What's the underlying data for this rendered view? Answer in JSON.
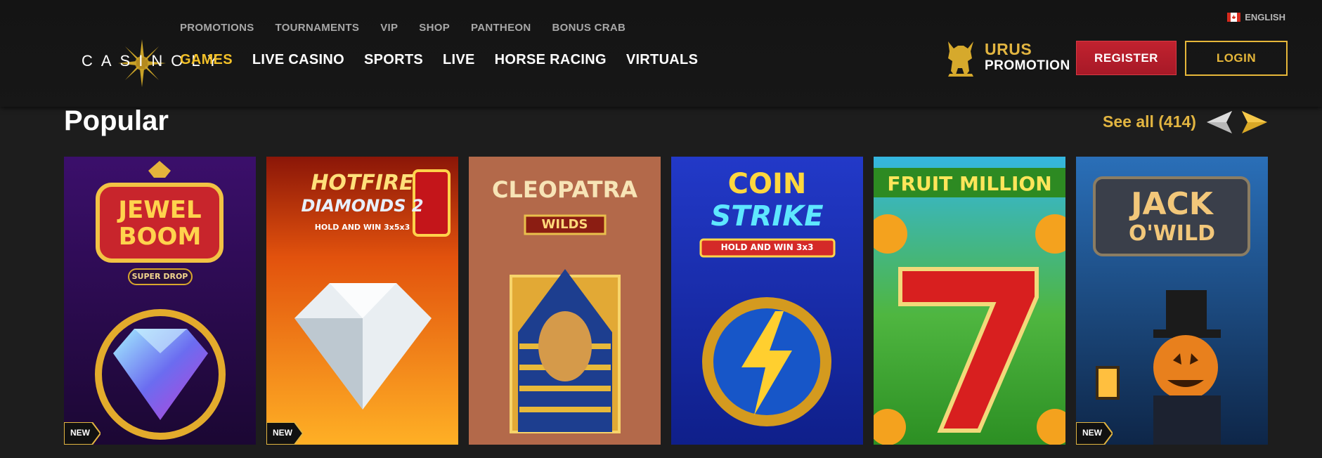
{
  "header": {
    "logo_text": "CASINOLY",
    "top_nav": [
      "PROMOTIONS",
      "TOURNAMENTS",
      "VIP",
      "SHOP",
      "PANTHEON",
      "BONUS CRAB"
    ],
    "main_nav": [
      "GAMES",
      "LIVE CASINO",
      "SPORTS",
      "LIVE",
      "HORSE RACING",
      "VIRTUALS"
    ],
    "active_main_nav": "GAMES",
    "language": "ENGLISH",
    "promo": {
      "title": "URUS",
      "subtitle": "PROMOTION"
    },
    "register_label": "REGISTER",
    "login_label": "LOGIN"
  },
  "section": {
    "title": "Popular",
    "see_all": "See all (414)"
  },
  "games": [
    {
      "title_line1": "JEWEL",
      "title_line2": "BOOM",
      "tag": "SUPER DROP",
      "badge": "NEW"
    },
    {
      "title_line1": "HOTFIRE",
      "title_line2": "DIAMONDS 2",
      "tag": "HOLD AND WIN 3x5x3",
      "badge": "NEW"
    },
    {
      "title_line1": "CLEOPATRA",
      "title_line2": "WILDS",
      "tag": "",
      "badge": ""
    },
    {
      "title_line1": "COIN",
      "title_line2": "STRIKE",
      "tag": "HOLD AND WIN 3x3",
      "badge": ""
    },
    {
      "title_line1": "FRUIT MILLION",
      "title_line2": "",
      "tag": "",
      "badge": ""
    },
    {
      "title_line1": "JACK",
      "title_line2": "O'WILD",
      "tag": "",
      "badge": "NEW"
    }
  ],
  "colors": {
    "accent_gold": "#e2b541",
    "active_nav": "#f2c028",
    "register_red": "#b81d2b",
    "background": "#1d1d1d"
  }
}
